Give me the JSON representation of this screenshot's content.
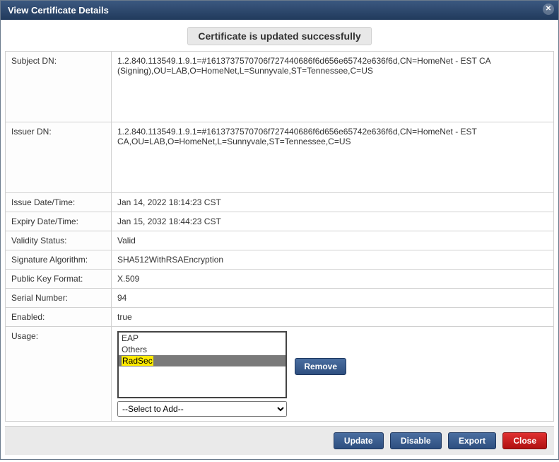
{
  "dialog": {
    "title": "View Certificate Details",
    "success": "Certificate is updated successfully"
  },
  "fields": {
    "subject_dn_label": "Subject DN:",
    "subject_dn_value": "1.2.840.113549.1.9.1=#1613737570706f727440686f6d656e65742e636f6d,CN=HomeNet - EST CA (Signing),OU=LAB,O=HomeNet,L=Sunnyvale,ST=Tennessee,C=US",
    "issuer_dn_label": "Issuer DN:",
    "issuer_dn_value": "1.2.840.113549.1.9.1=#1613737570706f727440686f6d656e65742e636f6d,CN=HomeNet - EST CA,OU=LAB,O=HomeNet,L=Sunnyvale,ST=Tennessee,C=US",
    "issue_date_label": "Issue Date/Time:",
    "issue_date_value": "Jan 14, 2022 18:14:23 CST",
    "expiry_date_label": "Expiry Date/Time:",
    "expiry_date_value": "Jan 15, 2032 18:44:23 CST",
    "validity_label": "Validity Status:",
    "validity_value": "Valid",
    "sig_alg_label": "Signature Algorithm:",
    "sig_alg_value": "SHA512WithRSAEncryption",
    "pk_format_label": "Public Key Format:",
    "pk_format_value": "X.509",
    "serial_label": "Serial Number:",
    "serial_value": "94",
    "enabled_label": "Enabled:",
    "enabled_value": "true",
    "usage_label": "Usage:"
  },
  "usage": {
    "items": [
      "EAP",
      "Others",
      "RadSec"
    ],
    "selected": "RadSec",
    "remove_label": "Remove",
    "select_placeholder": "--Select to Add--"
  },
  "buttons": {
    "update": "Update",
    "disable": "Disable",
    "export": "Export",
    "close": "Close"
  }
}
